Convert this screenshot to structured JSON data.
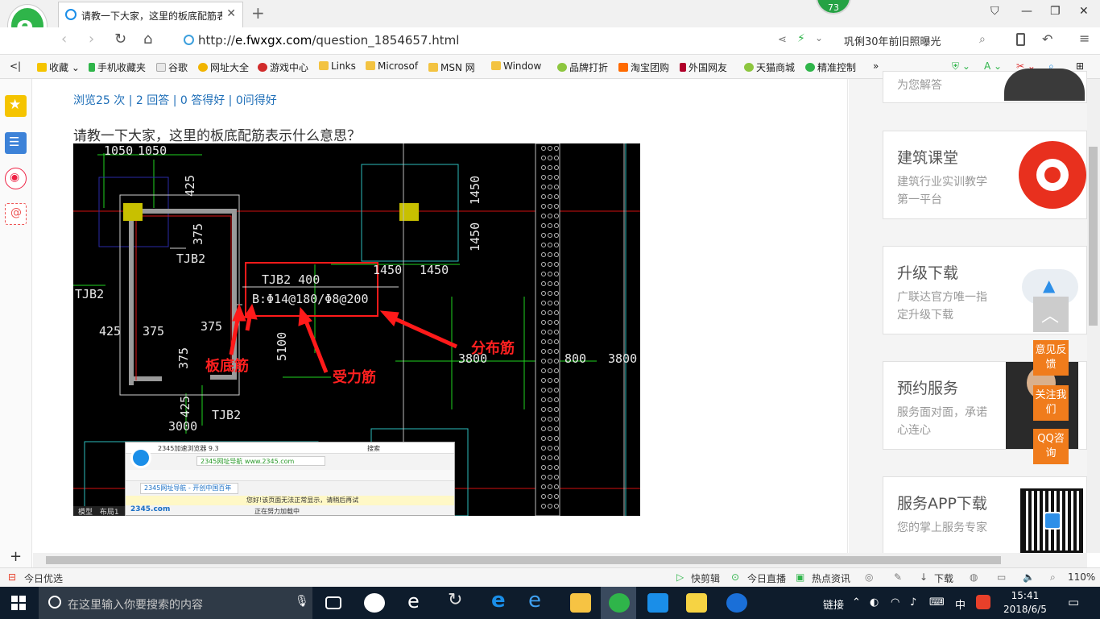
{
  "browser": {
    "tab_title": "请教一下大家，这里的板底配筋表",
    "badge_count": "73",
    "url_prefix": "http://",
    "url_host": "e.fwxgx.com",
    "url_path": "/question_1854657.html",
    "search_text": "巩俐30年前旧照曝光",
    "bookmarks": [
      "收藏",
      "手机收藏夹",
      "谷歌",
      "网址大全",
      "游戏中心",
      "Links",
      "Microsof",
      "MSN 网",
      "Window",
      "品牌打折",
      "淘宝团购",
      "外国网友",
      "天猫商城",
      "精准控制"
    ]
  },
  "page": {
    "stats": "浏览25 次 | 2 回答 | 0 答得好 | 0问得好",
    "question": "请教一下大家，这里的板底配筋表示什么意思？",
    "cad": {
      "dims": [
        "1050",
        "1050",
        "425",
        "375",
        "375",
        "425",
        "375",
        "375",
        "425",
        "3000",
        "1450",
        "1450",
        "1450",
        "1450",
        "5100",
        "3800",
        "800",
        "3800"
      ],
      "labels": [
        "TJB2",
        "TJB2",
        "TJB2",
        "TJB2 400",
        "B:Φ14@180/Φ8@200"
      ],
      "annot_bottom": "板底筋",
      "annot_force": "受力筋",
      "annot_dist": "分布筋",
      "inner_browser": {
        "title": "2345加速浏览器 9.3",
        "search": "搜索",
        "addr": "2345网址导航 www.2345.com",
        "tab": "2345网址导航 - 开创中国百年",
        "notice": "您好!该页面无法正常显示，请稍后再试",
        "body": "正在努力加载中",
        "brand": "2345.com",
        "bottom_tab1": "模型",
        "bottom_tab2": "布局1"
      }
    }
  },
  "sidebar": {
    "top_card_desc": "为您解答",
    "cards": [
      {
        "title": "建筑课堂",
        "desc": "建筑行业实训教学第一平台"
      },
      {
        "title": "升级下载",
        "desc": "广联达官方唯一指定升级下载"
      },
      {
        "title": "预约服务",
        "desc": "服务面对面，承诺心连心"
      },
      {
        "title": "服务APP下载",
        "desc": "您的掌上服务专家"
      }
    ],
    "float_btns": [
      "意见反馈",
      "关注我们",
      "QQ咨询"
    ]
  },
  "statusbar": {
    "left": "今日优选",
    "items": [
      "快剪辑",
      "今日直播",
      "热点资讯",
      "下载"
    ],
    "zoom": "110%"
  },
  "taskbar": {
    "search_placeholder": "在这里输入你要搜索的内容",
    "tray_link": "链接",
    "ime": "中",
    "time": "15:41",
    "date": "2018/6/5"
  },
  "colors": {
    "accent_green": "#2fb54a",
    "link_blue": "#1f6fb8",
    "orange": "#f07c1c",
    "annot_red": "#ff2020"
  }
}
